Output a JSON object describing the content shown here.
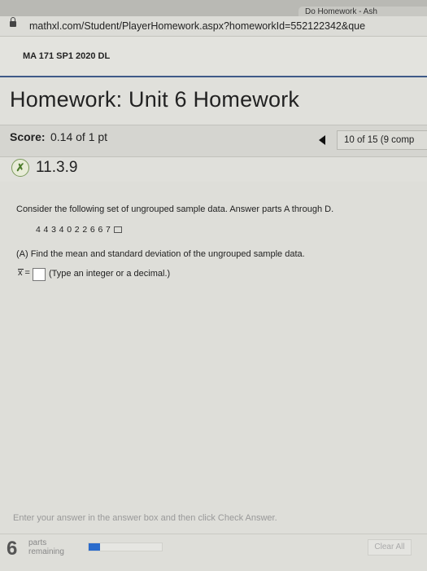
{
  "browser": {
    "tab_title": "Do Homework - Ash",
    "url": "mathxl.com/Student/PlayerHomework.aspx?homeworkId=552122342&que"
  },
  "course": {
    "name": "MA 171 SP1 2020 DL"
  },
  "homework": {
    "title": "Homework: Unit 6 Homework",
    "score_label": "Score:",
    "score_value": "0.14 of 1 pt",
    "question_counter": "10 of 15 (9 comp",
    "question_id": "11.3.9"
  },
  "question": {
    "prompt": "Consider the following set of ungrouped sample data. Answer parts A through D.",
    "data_values": "4  4  3  4  0  2  2  6  6  7",
    "part_a": "(A) Find the mean and standard deviation of the ungrouped sample data.",
    "answer_label": "x =",
    "answer_value": "",
    "answer_hint": "(Type an integer or a decimal.)"
  },
  "footer": {
    "instruction": "Enter your answer in the answer box and then click Check Answer.",
    "parts_count": "6",
    "parts_label_1": "parts",
    "parts_label_2": "remaining",
    "progress_fraction": 0.15,
    "progress_color": "#2a6bcc",
    "clear_all_label": "Clear All"
  },
  "icons": {
    "lock": "lock-icon",
    "prev": "prev-arrow-icon",
    "status": "partial-correct-icon",
    "copy": "copy-data-icon"
  }
}
